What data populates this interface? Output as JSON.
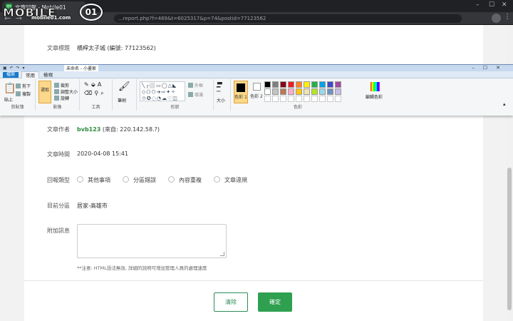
{
  "browser": {
    "tab_title": "文章回報 - Mobile01",
    "url": "...report.php?f=469&t=6025317&p=74&postid=77123562",
    "window_controls": [
      "–",
      "☐",
      "✕"
    ]
  },
  "logo": {
    "brand": "MOBILE",
    "domain": "mobile01.com",
    "badge": "01"
  },
  "form": {
    "title_label": "文章標題",
    "title_value": "橋桿太子城 (編號: 77123562)",
    "author_label": "文章作者",
    "author_name": "bvb123",
    "author_ip": "(來自: 220.142.58.?)",
    "time_label": "文章時間",
    "time_value": "2020-04-08 15:41",
    "type_label": "回報類型",
    "types": [
      "其他事項",
      "分區錯誤",
      "內容重複",
      "文章違規"
    ],
    "category_label": "目前分區",
    "category_value": "居家-高雄市",
    "extra_label": "附加訊息",
    "note": "**注意: HTML語法無效, 詳細的說明可增加管理人員的處理速度",
    "clear_button": "清除",
    "submit_button": "確定"
  },
  "paint": {
    "file_name": "未命名 - 小畫家",
    "file_tab": "檔案",
    "tabs": [
      "常用",
      "檢視"
    ],
    "groups": {
      "clipboard": {
        "label": "剪貼簿",
        "paste": "貼上",
        "cut": "剪下",
        "copy": "複製"
      },
      "image": {
        "label": "影像",
        "select": "選取",
        "crop": "裁剪",
        "resize": "調整大小",
        "rotate": "旋轉"
      },
      "tools": {
        "label": "工具"
      },
      "brush": {
        "label": "筆刷"
      },
      "shapes": {
        "label": "形狀",
        "outline": "外框",
        "fill": "填滿"
      },
      "size": {
        "label": "大小"
      },
      "colors": {
        "label": "色彩",
        "color1": "色彩 1",
        "color2": "色彩 2",
        "edit": "編輯色彩"
      }
    },
    "palette": [
      "#000000",
      "#7f7f7f",
      "#880015",
      "#ed1c24",
      "#ff7f27",
      "#fff200",
      "#22b14c",
      "#00a2e8",
      "#3f48cc",
      "#a349a4",
      "#ffffff",
      "#c3c3c3",
      "#b97a57",
      "#ffaec9",
      "#ffc90e",
      "#efe4b0",
      "#b5e61d",
      "#99d9ea",
      "#7092be",
      "#c8bfe7"
    ]
  }
}
